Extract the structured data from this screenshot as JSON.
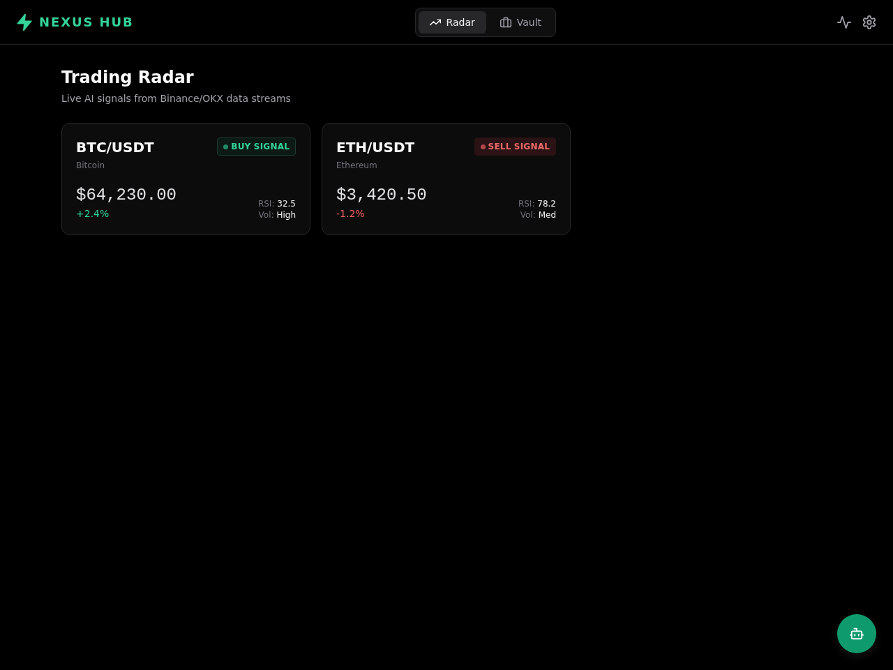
{
  "header": {
    "logo": "NEXUS HUB",
    "tabs": [
      {
        "label": "Radar",
        "selected": true
      },
      {
        "label": "Vault",
        "selected": false
      }
    ]
  },
  "page": {
    "title": "Trading Radar",
    "subtitle": "Live AI signals from Binance/OKX data streams"
  },
  "signals": [
    {
      "pair": "BTC/USDT",
      "name": "Bitcoin",
      "signal": {
        "kind": "buy",
        "label": "BUY SIGNAL"
      },
      "price": "$64,230.00",
      "change": {
        "text": "+2.4%",
        "kind": "gain"
      },
      "rsi_label": "RSI:",
      "rsi": "32.5",
      "vol_label": "Vol:",
      "vol": "High"
    },
    {
      "pair": "ETH/USDT",
      "name": "Ethereum",
      "signal": {
        "kind": "sell",
        "label": "SELL SIGNAL"
      },
      "price": "$3,420.50",
      "change": {
        "text": "-1.2%",
        "kind": "loss"
      },
      "rsi_label": "RSI:",
      "rsi": "78.2",
      "vol_label": "Vol:",
      "vol": "Med"
    }
  ]
}
